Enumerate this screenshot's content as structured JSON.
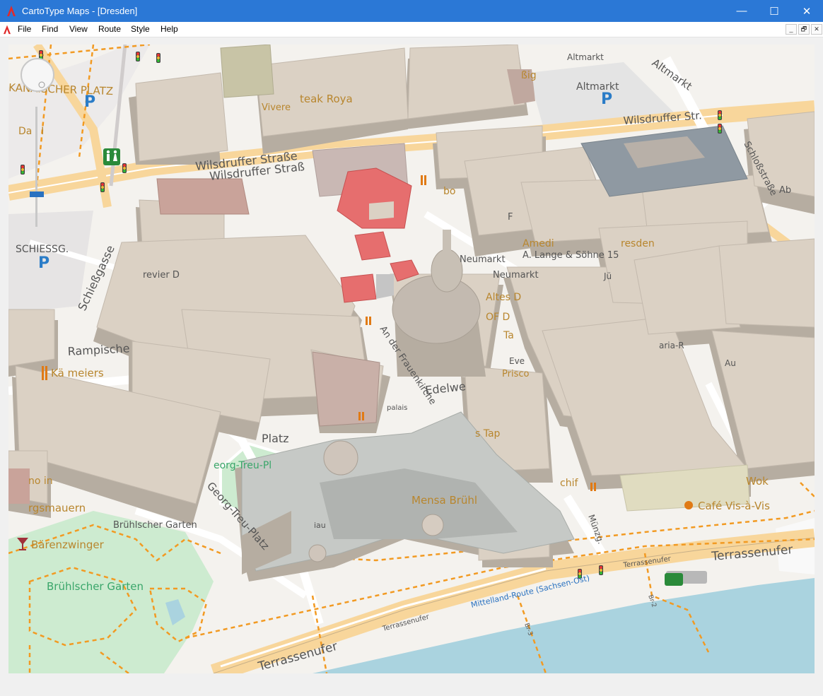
{
  "window": {
    "title": "CartoType Maps - [Dresden]",
    "minimize_glyph": "—",
    "maximize_glyph": "☐",
    "close_glyph": "✕"
  },
  "menu": {
    "items": [
      "File",
      "Find",
      "View",
      "Route",
      "Style",
      "Help"
    ],
    "mdi_controls": [
      "_",
      "🗗",
      "✕"
    ]
  },
  "map": {
    "labels": {
      "altmarkt": "Altmarkt",
      "altmarkt_street": "Altmarkt",
      "altmarkt_top": "Altmarkt",
      "wilsdruffer_1": "Wilsdruffer Straße",
      "wilsdruffer_2": "Wilsdruffer Straß",
      "wilsdruffer_3": "Wilsdruffer Str.",
      "schlossstr": "Schloßstraße",
      "schiessgasse": "Schießgasse",
      "schiessg": "SCHIESSG.",
      "rampische": "Rampische",
      "kanaischer": "KANAISCHER PLATZ",
      "georg_treu_platz": "Georg-Treu-Platz",
      "georg_treu_pl": "eorg-Treu-Pl",
      "platz": "Platz",
      "an_der_frauenkirche": "An der Frauenkirche",
      "neumarkt": "Neumarkt",
      "neumarkt2": "Neumarkt",
      "a_lange": "A. Lange & Söhne 15",
      "amedi": "Amedi",
      "resden": "resden",
      "edelwe": "Edelwe",
      "mensa": "Mensa Brühl",
      "bruehlscher_garten_street": "Brühlscher Garten",
      "bruehlscher_garten": "Brühlscher Garten",
      "baerenzwinger": "Bärenzwinger",
      "rgsmauern": "rgsmauern",
      "terrassenufer_1": "Terrassenufer",
      "terrassenufer_2": "Terrassenufer",
      "terrassenufer_small_1": "Terrassenufer",
      "terrassenufer_small_2": "Terrassenufer",
      "mittelland": "Mittelland-Route (Sachsen-Ost)",
      "cafe": "Café Vis-à-Vis",
      "wok": "Wok",
      "muenzg": "Münzg.",
      "kaemmeiers": "Kä  meiers",
      "br2": "Br-2",
      "br3": "Br-3",
      "steak_roya": "teak Roya",
      "vivere": "Vivere",
      "prevrier": "revier D",
      "altes_d": "Altes D",
      "of_d": "OF D",
      "ta": "Ta",
      "prisco": "Prisco",
      "eve": "Eve",
      "aria": "aria-R",
      "au": "Au",
      "bo": "bo",
      "ig": "ßig",
      "ab": "Ab",
      "platt": "palais",
      "jue": "Jü",
      "da_i": "Da i I",
      "tap": "s Tap",
      "no_in": "no in",
      "iau": "iau",
      "schif": "chif",
      "f_text": "F"
    },
    "parking_symbol": "P",
    "colors": {
      "building_top": "#dbd1c4",
      "building_side": "#b6ada1",
      "highlight": "#e66e6e",
      "park": "#cdebd0",
      "water": "#aad3df",
      "road_major": "#f8d69b",
      "footpath": "#f29a22",
      "label_brown": "#b8862e",
      "label_street": "#555555"
    }
  }
}
